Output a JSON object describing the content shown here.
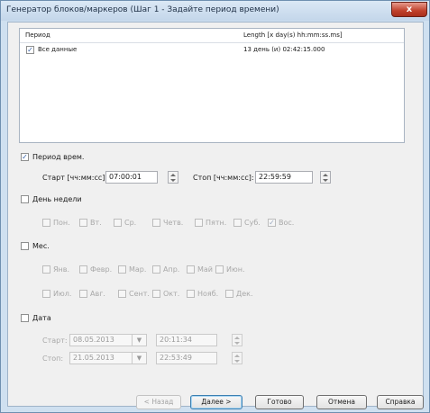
{
  "window": {
    "title": "Генератор блоков/маркеров (Шаг 1 - Задайте период времени)",
    "close_label": "x"
  },
  "list": {
    "columns": [
      "Период",
      "Length [x day(s) hh:mm:ss.ms]"
    ],
    "rows": [
      {
        "checked": true,
        "period": "Все данные",
        "length": "13 день (и) 02:42:15.000"
      }
    ]
  },
  "time_period": {
    "label": "Период врем.",
    "checked": true,
    "start_label": "Старт [чч:мм:сс]:",
    "start_value": "07:00:01",
    "stop_label": "Стоп [чч:мм:сс]:",
    "stop_value": "22:59:59"
  },
  "weekday": {
    "label": "День недели",
    "checked": false,
    "days": [
      {
        "label": "Пон.",
        "checked": false
      },
      {
        "label": "Вт.",
        "checked": false
      },
      {
        "label": "Ср.",
        "checked": false
      },
      {
        "label": "Четв.",
        "checked": false
      },
      {
        "label": "Пятн.",
        "checked": false
      },
      {
        "label": "Суб.",
        "checked": false
      },
      {
        "label": "Вос.",
        "checked": true
      }
    ]
  },
  "month": {
    "label": "Мес.",
    "checked": false,
    "months": [
      {
        "label": "Янв."
      },
      {
        "label": "Февр."
      },
      {
        "label": "Мар."
      },
      {
        "label": "Апр."
      },
      {
        "label": "Май"
      },
      {
        "label": "Июн."
      },
      {
        "label": "Июл."
      },
      {
        "label": "Авг."
      },
      {
        "label": "Сент."
      },
      {
        "label": "Окт."
      },
      {
        "label": "Нояб."
      },
      {
        "label": "Дек."
      }
    ]
  },
  "date": {
    "label": "Дата",
    "checked": false,
    "start_label": "Старт:",
    "start_date": "08.05.2013",
    "start_time": "20:11:34",
    "stop_label": "Стоп:",
    "stop_date": "21.05.2013",
    "stop_time": "22:53:49"
  },
  "buttons": {
    "back": "< Назад",
    "next": "Далее >",
    "finish": "Готово",
    "cancel": "Отмена",
    "help": "Справка"
  }
}
